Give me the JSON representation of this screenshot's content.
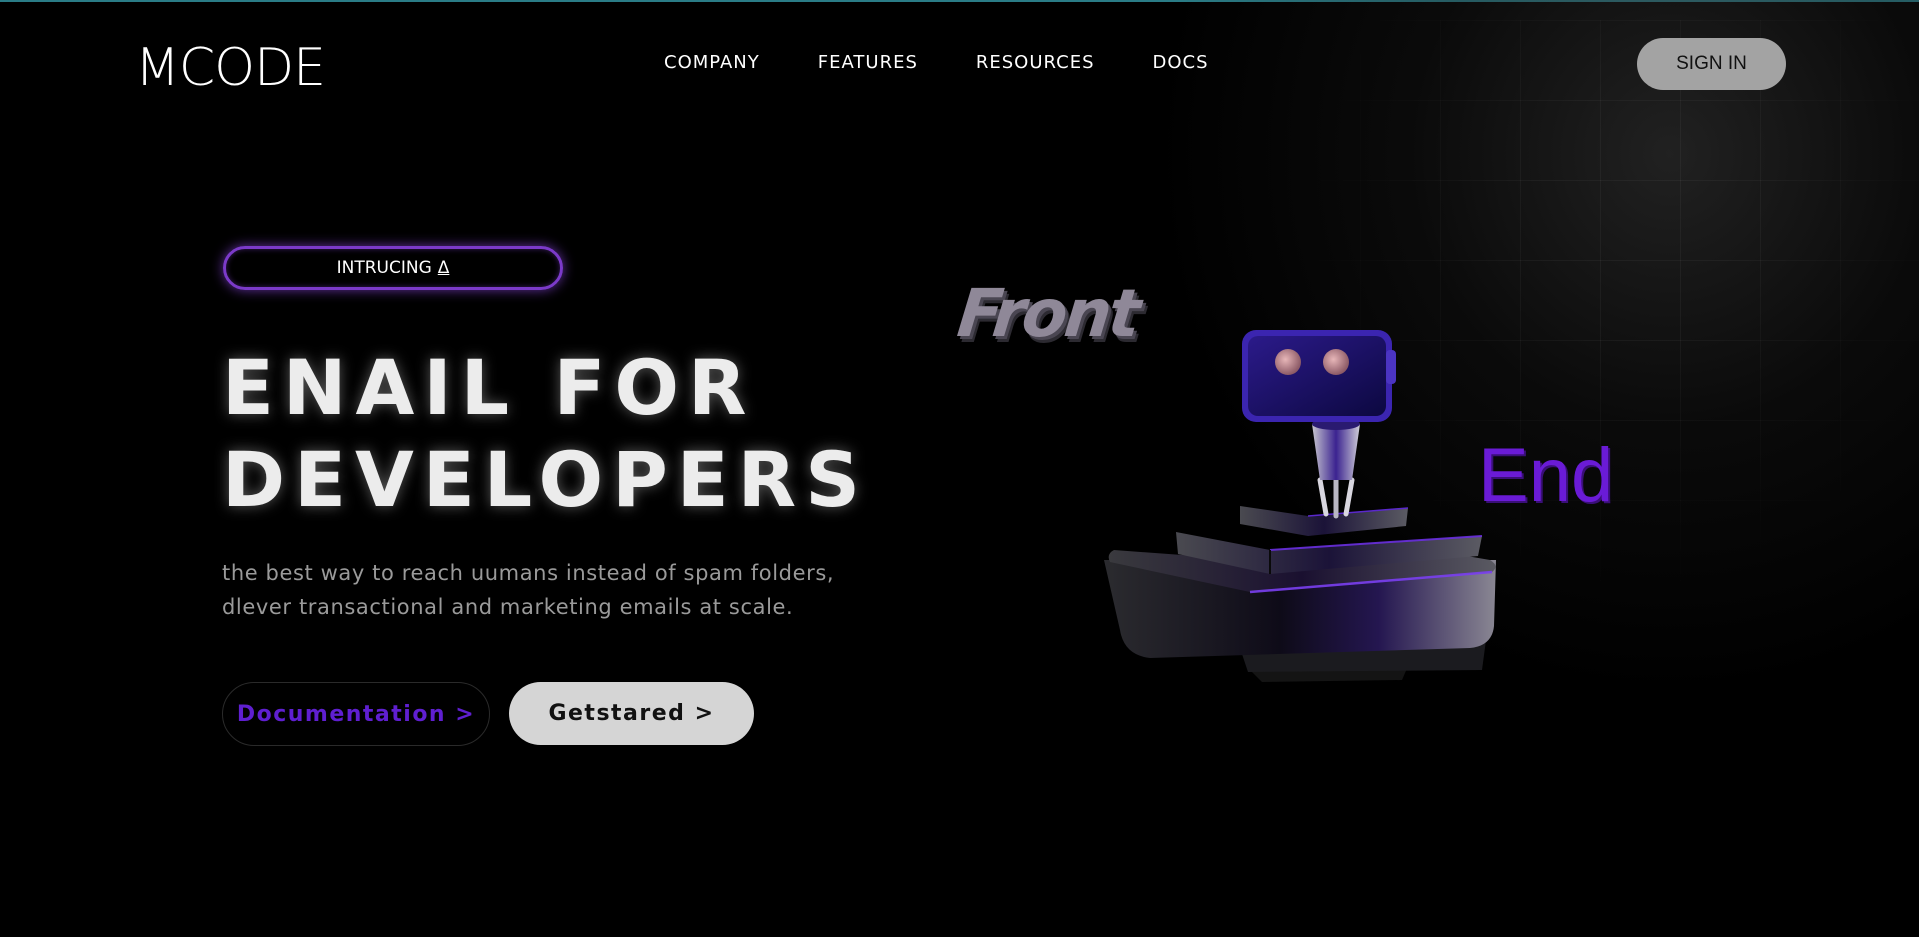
{
  "header": {
    "logo": "MCODE",
    "nav": [
      "COMPANY",
      "FEATURES",
      "RESOURCES",
      "DOCS"
    ],
    "signin_label": "SIGN IN"
  },
  "hero": {
    "badge_text": "INTRUCING",
    "badge_symbol": "Δ",
    "headline_line1": "ENAIL FOR",
    "headline_line2": "DEVELOPERS",
    "subtext_line1": "the best way to reach uumans instead of spam folders,",
    "subtext_line2": "dlever transactional and marketing emails at scale.",
    "doc_button": "Documentation >",
    "start_button": "Getstared >"
  },
  "illustration": {
    "front_text": "Front",
    "end_text": "End",
    "icons": [
      "robot-icon",
      "pedestal-icon"
    ]
  },
  "colors": {
    "accent_purple": "#6a1bd6",
    "pill_border": "#7b3ac9",
    "signin_bg": "#a3a3a3",
    "start_bg": "#d5d5d5"
  }
}
